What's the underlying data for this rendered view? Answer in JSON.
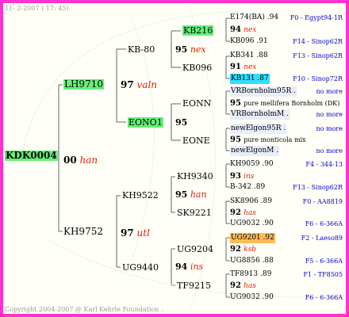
{
  "header": {
    "text": "11- 2-2007 ( 17: 45)"
  },
  "footer": {
    "text": "Copyright 2004-2007 @ Karl Kehrle Foundation ."
  },
  "root": {
    "name": "KDK0004"
  },
  "gen1": {
    "top": {
      "name": "LH9710"
    },
    "bottom": {
      "name": "KH9752"
    },
    "mark": {
      "num": "00",
      "label": "han"
    }
  },
  "gen2": {
    "lh": {
      "num": "97",
      "label": "valn"
    },
    "kh": {
      "num": "97",
      "label": "utl"
    },
    "kb80": "KB-80",
    "eono1": "EONO1",
    "kh9522": "KH9522",
    "ug9440": "UG9440"
  },
  "gen3": {
    "kb80": {
      "num": "95",
      "label": "nex"
    },
    "eono1": {
      "num": "95",
      "label": ""
    },
    "kh9522": {
      "num": "95",
      "label": "han"
    },
    "ug9440": {
      "num": "94",
      "label": "ins"
    },
    "kb216": "KB216",
    "kb096": "KB096",
    "eonn": "EONN",
    "eone": "EONE",
    "kh9340": "KH9340",
    "sk9221": "SK9221",
    "ug9204": "UG9204",
    "tf9215": "TF9215"
  },
  "leaves": [
    {
      "top": "E174(BA) .94",
      "top_src": "F0 - Egypt94-1R",
      "mid_num": "94",
      "mid_label": "nex",
      "mid_text": "",
      "bot": "KB096 .91",
      "bot_src": "F14 - Sinop62R"
    },
    {
      "top": "KB341 .88",
      "top_src": "F13 - Sinop62R",
      "mid_num": "91",
      "mid_label": "nex",
      "mid_text": "",
      "bot": "KB131 .87",
      "bot_src": "F10 - Sinop72R"
    },
    {
      "top": "VRBornholm95R .",
      "top_src": "no more",
      "mid_num": "95",
      "mid_label": "",
      "mid_text": "pure mellifera Bornholm (DK)",
      "bot": "VRBornholmM .",
      "bot_src": "no more"
    },
    {
      "top": "newElgon95R .",
      "top_src": "no more",
      "mid_num": "95",
      "mid_label": "",
      "mid_text": "pure monticola mix",
      "bot": "newElgonM .",
      "bot_src": "no more"
    },
    {
      "top": "KH9059 .90",
      "top_src": "F4 - 344-13",
      "mid_num": "93",
      "mid_label": "ins",
      "mid_text": "",
      "bot": "B-342 .89",
      "bot_src": "F13 - Sinop62R"
    },
    {
      "top": "SK8906 .89",
      "top_src": "F0 - AA8819",
      "mid_num": "92",
      "mid_label": "has",
      "mid_text": "",
      "bot": "UG9032 .90",
      "bot_src": "F6 - 6-366A"
    },
    {
      "top": "UG9201 .92",
      "top_src": "F2 - Laeso89",
      "mid_num": "92",
      "mid_label": "ksb",
      "mid_text": "",
      "bot": "UG8856 .88",
      "bot_src": "F5 - 6-366A"
    },
    {
      "top": "TF8913 .89",
      "top_src": "F1 - TF8505",
      "mid_num": "92",
      "mid_label": "has",
      "mid_text": "",
      "bot": "UG9032 .90",
      "bot_src": "F6 - 6-366A"
    }
  ],
  "colors": {
    "frame": "#ff33cc",
    "green_highlight": "#66ee77",
    "cyan_highlight": "#33ddff",
    "orange_highlight": "#ffbb55",
    "label_red": "#dd2200",
    "source_blue": "#0000cc"
  }
}
